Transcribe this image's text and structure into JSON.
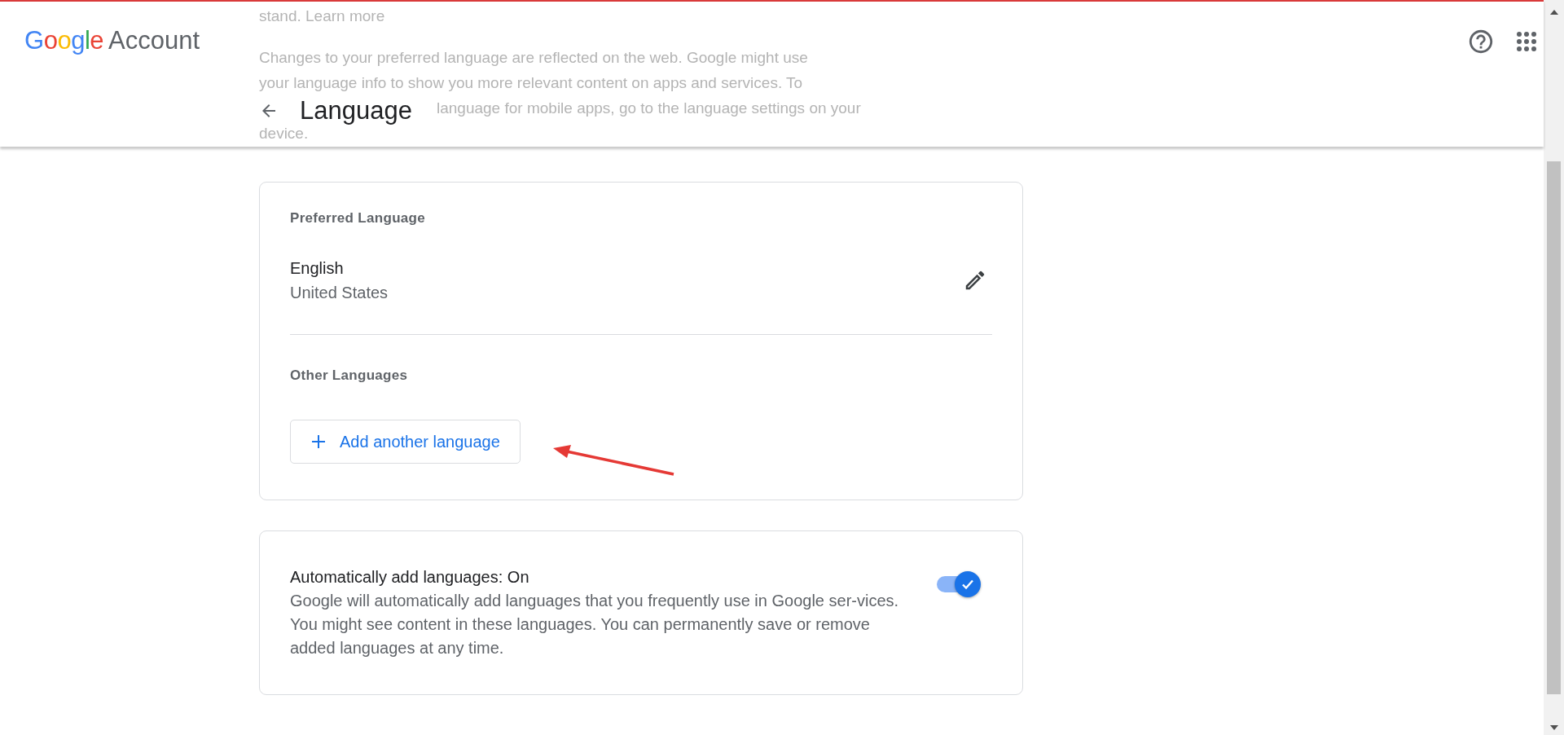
{
  "header": {
    "logo": {
      "brand": "Google",
      "product": "Account"
    },
    "background_text": [
      "stand. Learn more",
      "Changes to your preferred language are reflected on the web. Google might use",
      "your language info to show you more relevant content on apps and services. To",
      "language for mobile apps, go to the language settings on your",
      "device."
    ],
    "page_title": "Language"
  },
  "preferred": {
    "heading": "Preferred Language",
    "language": "English",
    "region": "United States"
  },
  "other": {
    "heading": "Other Languages",
    "add_button": "Add another language"
  },
  "auto_add": {
    "title": "Automatically add languages: On",
    "description": "Google will automatically add languages that you frequently use in Google ser-vices. You might see content in these languages. You can permanently save or remove added languages at any time.",
    "on": true
  }
}
